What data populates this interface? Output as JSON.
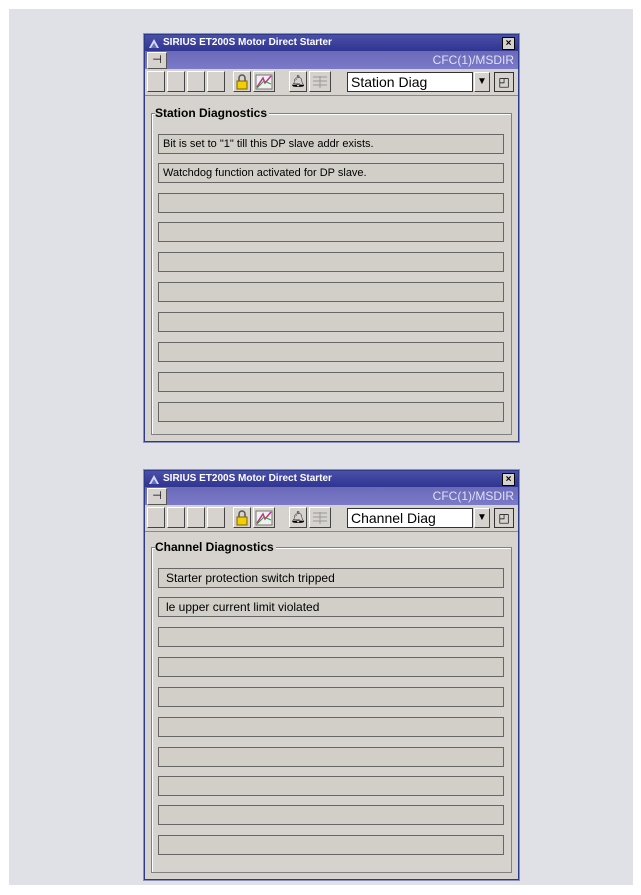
{
  "faceplates": [
    {
      "title": "SIRIUS ET200S Motor Direct Starter",
      "path": "CFC(1)/MSDIR",
      "view_selected": "Station Diag",
      "group_title": "Station Diagnostics",
      "rows": [
        "Bit is set to \"1\" till this DP slave addr exists.",
        "Watchdog function activated for DP slave.",
        "",
        "",
        "",
        "",
        "",
        "",
        "",
        ""
      ]
    },
    {
      "title": "SIRIUS ET200S Motor Direct Starter",
      "path": "CFC(1)/MSDIR",
      "view_selected": "Channel Diag",
      "group_title": "Channel Diagnostics",
      "rows": [
        "Starter protection switch tripped",
        "le upper current limit violated",
        "",
        "",
        "",
        "",
        "",
        "",
        "",
        ""
      ]
    }
  ],
  "icons": {
    "pin": "pin-icon",
    "lock": "lock-icon",
    "trend": "trend-icon",
    "bell": "bell-icon",
    "table": "table-icon",
    "resize": "resize-icon",
    "close": "close-icon"
  },
  "colors": {
    "titlebar": "#2f3590",
    "pathbar": "#7070c0",
    "panel": "#d6d3ce",
    "lock_yellow": "#f0d000"
  }
}
